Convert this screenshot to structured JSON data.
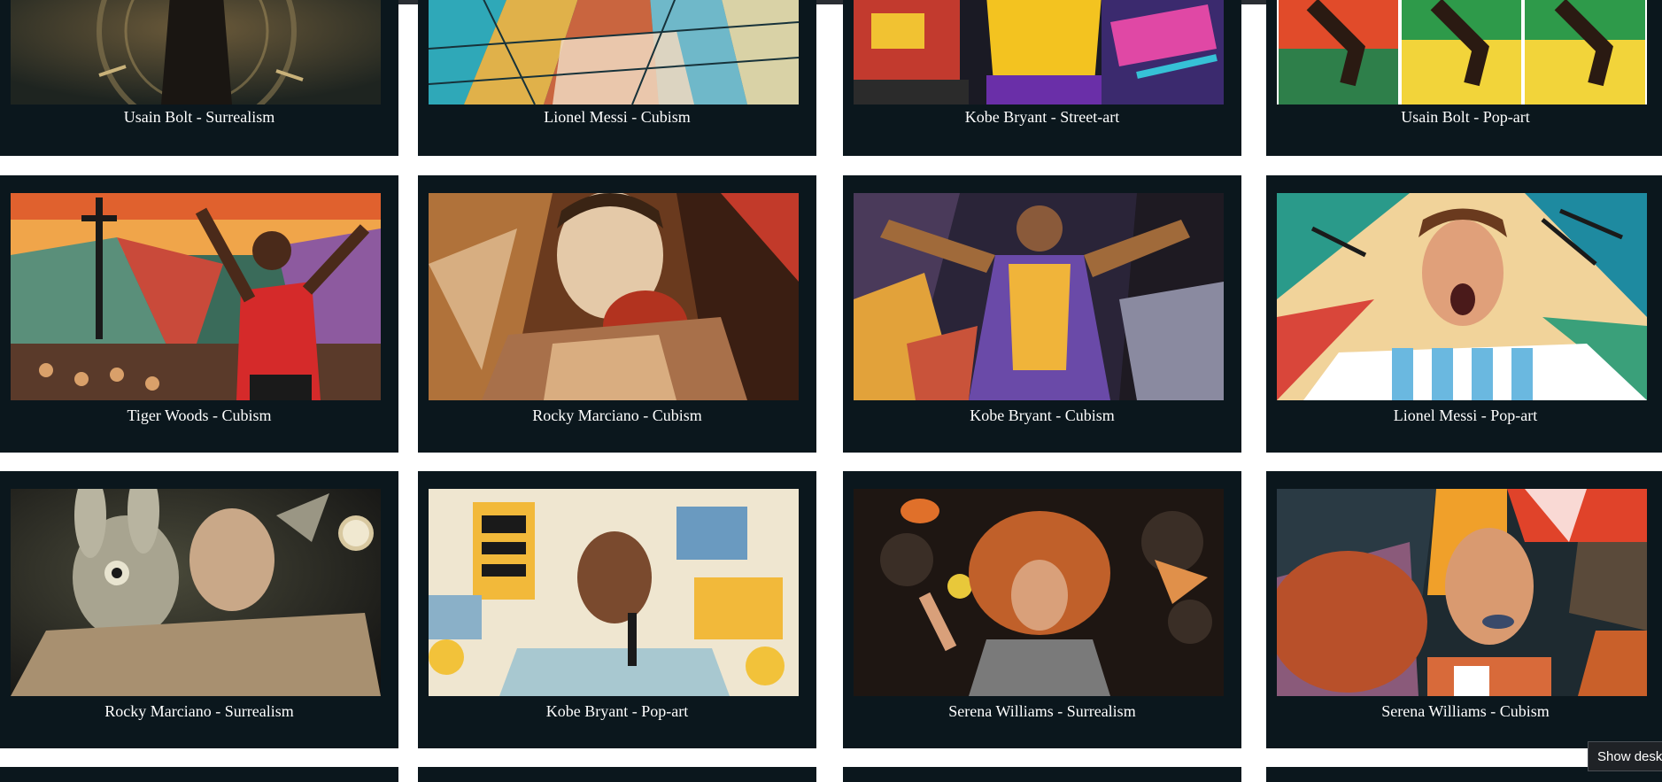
{
  "gallery": {
    "cards": [
      {
        "caption": "Usain Bolt - Surrealism"
      },
      {
        "caption": "Lionel Messi - Cubism"
      },
      {
        "caption": "Kobe Bryant - Street-art"
      },
      {
        "caption": "Usain Bolt - Pop-art"
      },
      {
        "caption": "Tiger Woods - Cubism"
      },
      {
        "caption": "Rocky Marciano - Cubism"
      },
      {
        "caption": "Kobe Bryant - Cubism"
      },
      {
        "caption": "Lionel Messi - Pop-art"
      },
      {
        "caption": "Rocky Marciano - Surrealism"
      },
      {
        "caption": "Kobe Bryant - Pop-art"
      },
      {
        "caption": "Serena Williams - Surrealism"
      },
      {
        "caption": "Serena Williams - Cubism"
      }
    ]
  },
  "taskbar": {
    "tooltip": "Show desktop"
  }
}
